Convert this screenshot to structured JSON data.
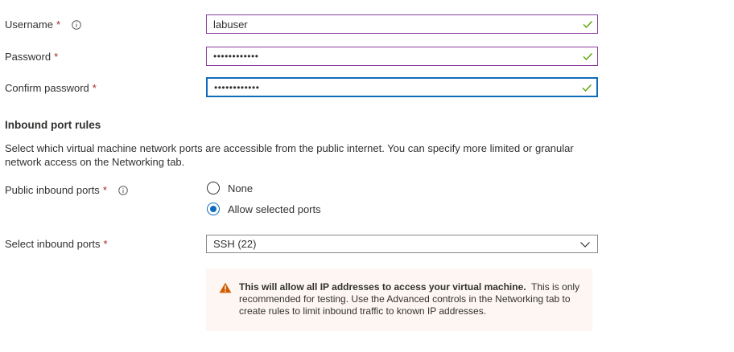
{
  "fields": {
    "username": {
      "label": "Username",
      "value": "labuser"
    },
    "password": {
      "label": "Password",
      "value": "••••••••••••"
    },
    "confirm_password": {
      "label": "Confirm password",
      "value": "••••••••••••"
    }
  },
  "required_mark": "*",
  "inbound": {
    "title": "Inbound port rules",
    "description": "Select which virtual machine network ports are accessible from the public internet. You can specify more limited or granular network access on the Networking tab.",
    "public_ports_label": "Public inbound ports",
    "options": [
      {
        "label": "None",
        "selected": false
      },
      {
        "label": "Allow selected ports",
        "selected": true
      }
    ],
    "select_label": "Select inbound ports",
    "select_value": "SSH (22)"
  },
  "warning": {
    "bold": "This will allow all IP addresses to access your virtual machine.",
    "text": "This is only recommended for testing.  Use the Advanced controls in the Networking tab to create rules to limit inbound traffic to known IP addresses."
  },
  "colors": {
    "valid_border": "#8a3fa0",
    "focus_border": "#0f6cbd",
    "check": "#57a300",
    "required": "#a4262c",
    "warning_icon": "#d15d00",
    "warning_bg": "#fdf6f2"
  },
  "icons": [
    "info-icon",
    "check-icon",
    "chevron-down-icon",
    "warning-icon"
  ]
}
